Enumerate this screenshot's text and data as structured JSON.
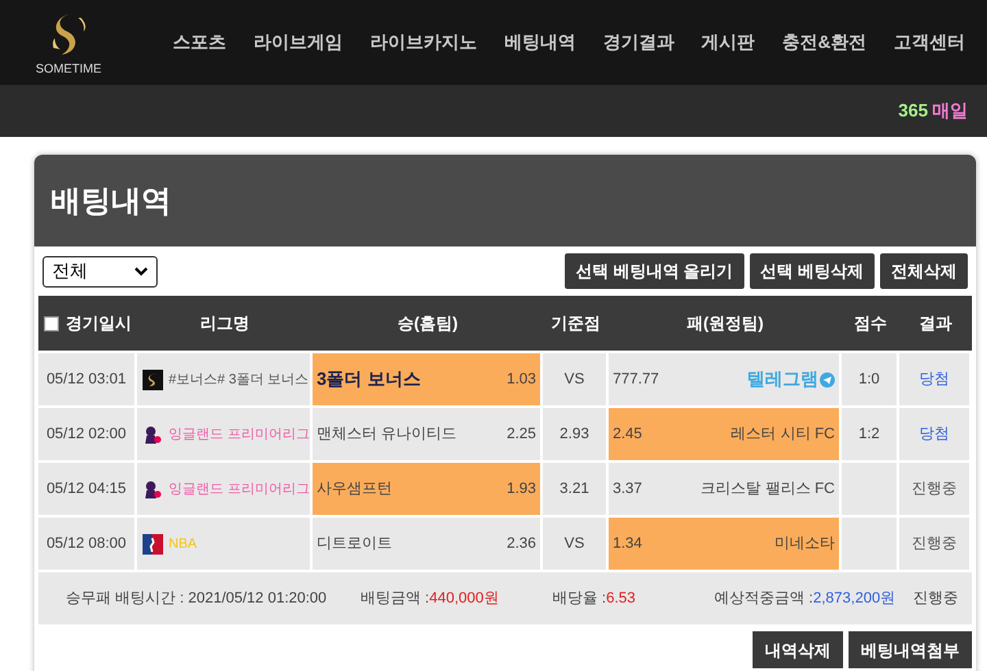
{
  "logo": {
    "text": "SOMETIME"
  },
  "nav": [
    {
      "label": "스포츠"
    },
    {
      "label": "라이브게임"
    },
    {
      "label": "라이브카지노"
    },
    {
      "label": "베팅내역"
    },
    {
      "label": "경기결과"
    },
    {
      "label": "게시판"
    },
    {
      "label": "충전&환전"
    },
    {
      "label": "고객센터"
    }
  ],
  "promo": {
    "number": "365",
    "label": "매일"
  },
  "page_title": "배팅내역",
  "filter": {
    "value": "전체"
  },
  "actions": [
    "선택 베팅내역 올리기",
    "선택 베팅삭제",
    "전체삭제"
  ],
  "table": {
    "select_all": {
      "checked": false
    },
    "columns": [
      "경기일시",
      "리그명",
      "승(홈팀)",
      "기준점",
      "패(원정팀)",
      "점수",
      "결과"
    ],
    "rows": [
      {
        "time": "05/12 03:01",
        "league": {
          "kind": "site",
          "name": "#보너스# 3폴더 보너스",
          "color": "#555555"
        },
        "home": {
          "name": "3폴더 보너스",
          "kind": "bonus",
          "odds": "1.03",
          "selected": true
        },
        "base": "VS",
        "away": {
          "odds": "777.77",
          "name": "텔레그램",
          "kind": "telegram",
          "selected": false
        },
        "score": "1:0",
        "result": {
          "text": "당첨",
          "won": true
        }
      },
      {
        "time": "05/12 02:00",
        "league": {
          "kind": "premier",
          "name": "잉글랜드 프리미어리그",
          "color": "#ef5da8"
        },
        "home": {
          "name": "맨체스터 유나이티드",
          "kind": "team",
          "odds": "2.25",
          "selected": false
        },
        "base": "2.93",
        "away": {
          "odds": "2.45",
          "name": "레스터 시티 FC",
          "kind": "team",
          "selected": true
        },
        "score": "1:2",
        "result": {
          "text": "당첨",
          "won": true
        }
      },
      {
        "time": "05/12 04:15",
        "league": {
          "kind": "premier",
          "name": "잉글랜드 프리미어리그",
          "color": "#ef5da8"
        },
        "home": {
          "name": "사우샘프턴",
          "kind": "team",
          "odds": "1.93",
          "selected": true
        },
        "base": "3.21",
        "away": {
          "odds": "3.37",
          "name": "크리스탈 팰리스 FC",
          "kind": "team",
          "selected": false
        },
        "result": {
          "text": "진행중",
          "won": false
        }
      },
      {
        "time": "05/12 08:00",
        "league": {
          "kind": "nba",
          "name": "NBA",
          "color": "#f5c518"
        },
        "home": {
          "name": "디트로이트",
          "kind": "team",
          "odds": "2.36",
          "selected": false
        },
        "base": "VS",
        "away": {
          "odds": "1.34",
          "name": "미네소타",
          "kind": "team",
          "selected": true
        },
        "result": {
          "text": "진행중",
          "won": false
        }
      }
    ]
  },
  "summary": {
    "bet_time": "승무패 배팅시간 : 2021/05/12 01:20:00",
    "amount_label": "배팅금액 :",
    "amount": "440,000원",
    "rate_label": "배당율 :",
    "rate": "6.53",
    "expected_label": "예상적중금액 :",
    "expected": "2,873,200원",
    "status": "진행중"
  },
  "bottom_actions": [
    "내역삭제",
    "베팅내역첨부"
  ]
}
